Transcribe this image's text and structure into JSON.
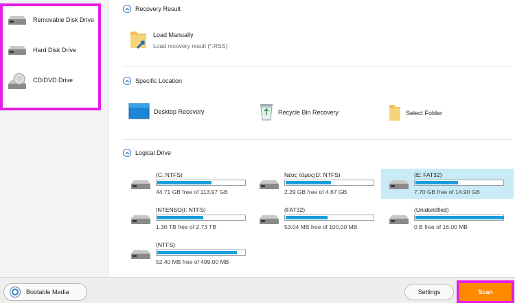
{
  "left_panel": {
    "items": [
      {
        "label": "Removable Disk Drive",
        "icon": "removable-disk-icon"
      },
      {
        "label": "Hard Disk Drive",
        "icon": "hard-disk-icon"
      },
      {
        "label": "CD/DVD Drive",
        "icon": "cd-dvd-icon"
      }
    ]
  },
  "sections": {
    "recovery_result": {
      "title": "Recovery Result",
      "load_manually": {
        "label": "Load Manually",
        "sub": "Load recovery result (*.RSS)"
      }
    },
    "specific_location": {
      "title": "Specific Location",
      "items": [
        {
          "label": "Desktop Recovery",
          "icon": "desktop-icon"
        },
        {
          "label": "Recycle Bin Recovery",
          "icon": "recycle-bin-icon"
        },
        {
          "label": "Select Folder",
          "icon": "folder-icon"
        }
      ]
    },
    "logical_drive": {
      "title": "Logical Drive",
      "drives": [
        {
          "name": "(C: NTFS)",
          "free": "44.71 GB free of 113.97 GB",
          "used_fraction": 0.61
        },
        {
          "name": "Νέος τόμος(D: NTFS)",
          "free": "2.29 GB free of 4.67 GB",
          "used_fraction": 0.51
        },
        {
          "name": "(E: FAT32)",
          "free": "7.70 GB free of 14.90 GB",
          "used_fraction": 0.48,
          "selected": true
        },
        {
          "name": "INTENSO(I: NTFS)",
          "free": "1.30 TB free of 2.73 TB",
          "used_fraction": 0.52
        },
        {
          "name": "(FAT32)",
          "free": "53.04 MB free of 100.00 MB",
          "used_fraction": 0.47
        },
        {
          "name": "(Unidentified)",
          "free": "0 B free of 16.00 MB",
          "used_fraction": 1.0
        },
        {
          "name": "(NTFS)",
          "free": "52.40 MB free of 499.00 MB",
          "used_fraction": 0.9
        }
      ]
    }
  },
  "footer": {
    "bootable_label": "Bootable Media",
    "settings_label": "Settings",
    "scan_label": "Scan"
  },
  "colors": {
    "accent": "#1a9ddd",
    "highlight": "#e41ee4",
    "scan": "#ff8a00",
    "selected": "#c9ebf6"
  }
}
